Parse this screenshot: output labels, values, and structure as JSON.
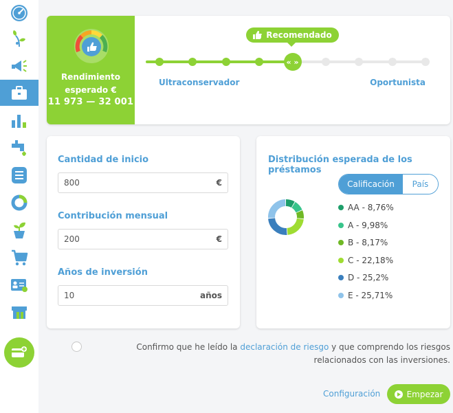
{
  "sidebar": {
    "items": [
      {
        "icon": "dashboard-gauge-icon"
      },
      {
        "icon": "plant-growth-icon"
      },
      {
        "icon": "megaphone-icon"
      },
      {
        "icon": "briefcase-icon",
        "active": true
      },
      {
        "icon": "bar-chart-icon"
      },
      {
        "icon": "faucet-icon"
      },
      {
        "icon": "document-list-icon"
      },
      {
        "icon": "ring-chart-icon"
      },
      {
        "icon": "seedling-pot-icon"
      },
      {
        "icon": "shopping-cart-icon"
      },
      {
        "icon": "id-card-icon"
      },
      {
        "icon": "shop-awning-icon"
      }
    ],
    "promo_icon": "add-card-icon"
  },
  "portfolio": {
    "yield_label": "Rendimiento esperado €",
    "yield_range": "11 973 — 32 001",
    "recommended_label": "Recomendado",
    "risk_min_label": "Ultraconservador",
    "risk_max_label": "Oportunista",
    "risk_levels": 9,
    "selected_level": 5,
    "handle_glyph": "« »"
  },
  "inputs": {
    "start_amount": {
      "label": "Cantidad de inicio",
      "value": "800",
      "unit": "€"
    },
    "monthly_contribution": {
      "label": "Contribución mensual",
      "value": "200",
      "unit": "€"
    },
    "years": {
      "label": "Años de inversión",
      "value": "10",
      "unit": "años"
    }
  },
  "distribution": {
    "title": "Distribución esperada de los préstamos",
    "toggle": {
      "active": "Calificación",
      "inactive": "País"
    },
    "legend": [
      {
        "label": "AA - 8,76%",
        "color": "#1e9e6a"
      },
      {
        "label": "A - 9,98%",
        "color": "#38c48b"
      },
      {
        "label": "B - 8,17%",
        "color": "#6fb825"
      },
      {
        "label": "C - 22,18%",
        "color": "#9fdc32"
      },
      {
        "label": "D - 25,2%",
        "color": "#3a7fbd"
      },
      {
        "label": "E - 25,71%",
        "color": "#8fc3ea"
      }
    ]
  },
  "chart_data": {
    "type": "pie",
    "categories": [
      "AA",
      "A",
      "B",
      "C",
      "D",
      "E"
    ],
    "values": [
      8.76,
      9.98,
      8.17,
      22.18,
      25.2,
      25.71
    ],
    "colors": [
      "#1e9e6a",
      "#38c48b",
      "#6fb825",
      "#9fdc32",
      "#3a7fbd",
      "#8fc3ea"
    ]
  },
  "consent": {
    "before": "Confirmo que he leído la ",
    "link": "declaración de riesgo",
    "after": " y que comprendo los riesgos relacionados con las inversiones."
  },
  "actions": {
    "config_label": "Configuración",
    "start_label": "Empezar"
  },
  "colors": {
    "accent_green": "#8dd235",
    "accent_blue": "#4f9fd6"
  }
}
